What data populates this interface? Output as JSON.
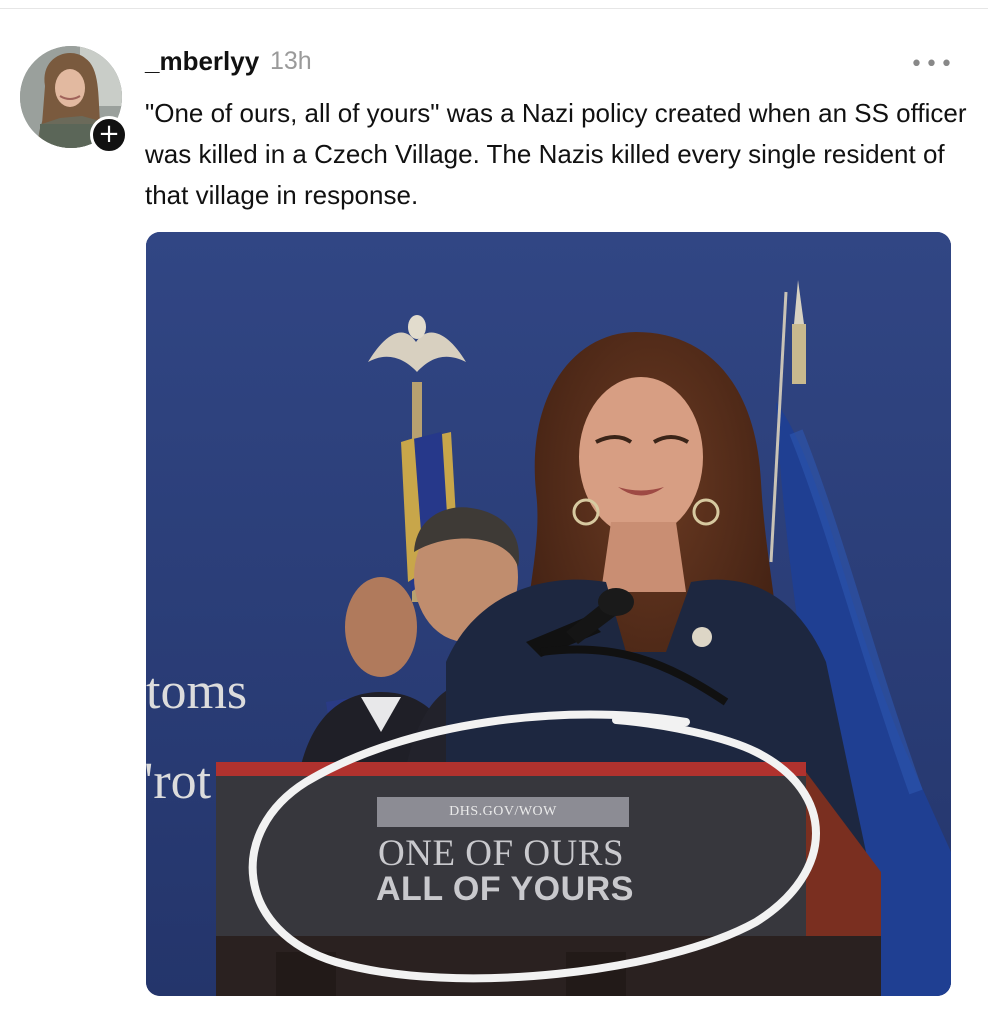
{
  "post": {
    "username": "_mberlyy",
    "timestamp": "13h",
    "follow_icon": "plus-icon",
    "more_icon": "more-options-icon",
    "caption": "\"One of ours, all of yours\" was a Nazi policy created when an SS officer was killed in a Czech Village. The Nazis killed every single resident of that village in response."
  },
  "photo": {
    "podium_url": "DHS.GOV/WOW",
    "podium_line1": "ONE OF OURS",
    "podium_line2": "ALL OF YOURS",
    "wall_text_line1": "toms",
    "wall_text_line2": "'rot"
  }
}
